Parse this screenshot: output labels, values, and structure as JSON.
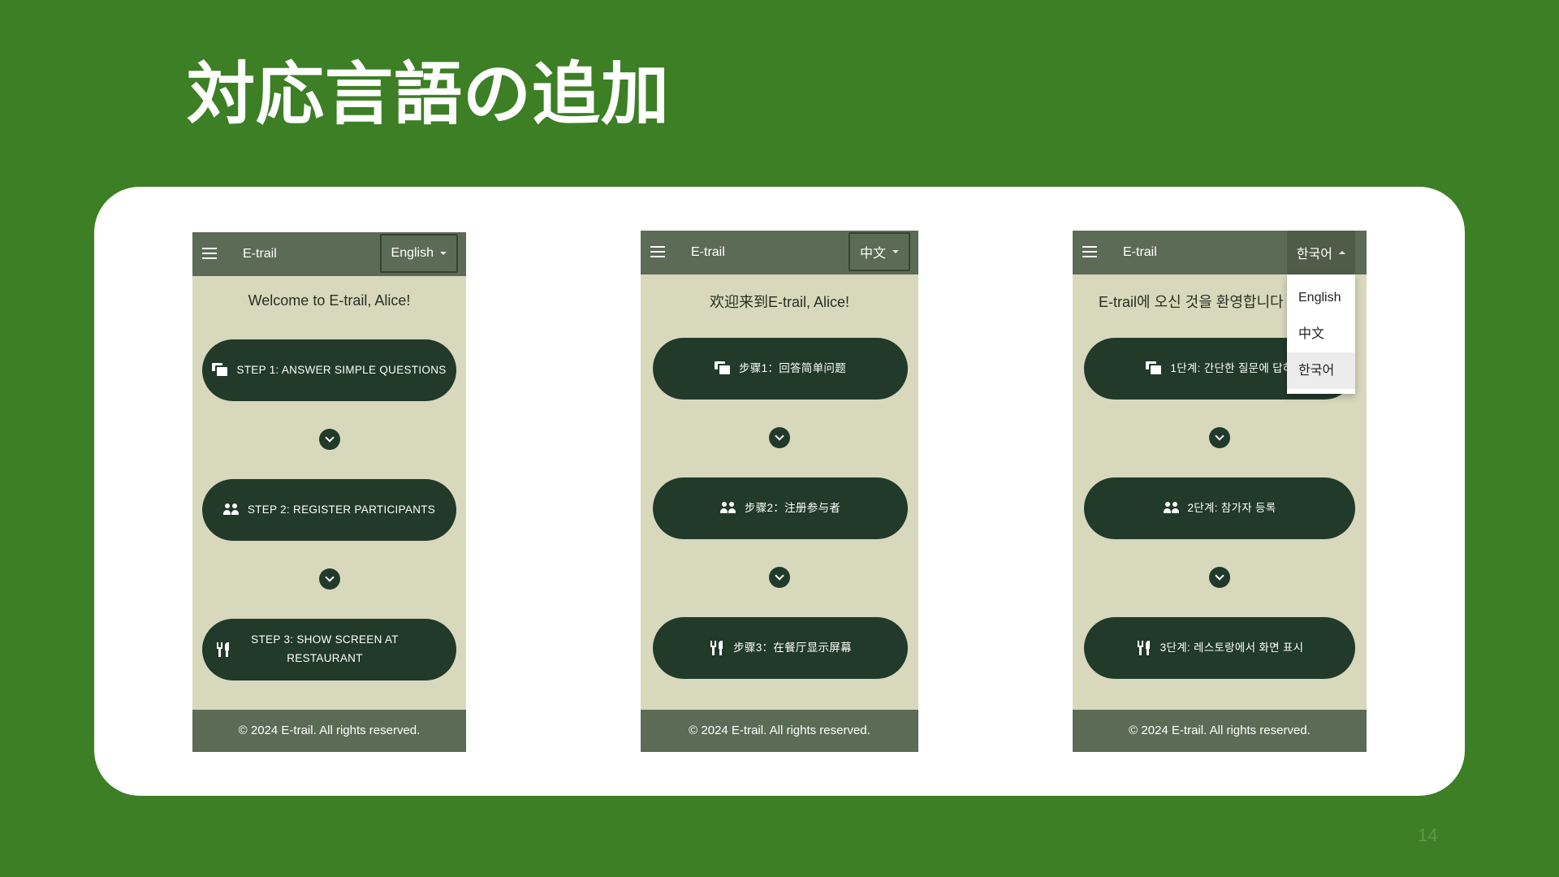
{
  "slide": {
    "title": "対応言語の追加",
    "page_number": "14"
  },
  "phones": [
    {
      "app_title": "E-trail",
      "language": "English",
      "welcome": "Welcome to E-trail, Alice!",
      "steps": [
        "STEP 1: ANSWER SIMPLE QUESTIONS",
        "STEP 2: REGISTER PARTICIPANTS",
        "STEP 3: SHOW SCREEN AT RESTAURANT"
      ],
      "footer": "© 2024 E-trail. All rights reserved."
    },
    {
      "app_title": "E-trail",
      "language": "中文",
      "welcome": "欢迎来到E-trail, Alice!",
      "steps": [
        "步骤1：回答简单问题",
        "步骤2：注册参与者",
        "步骤3：在餐厅显示屏幕"
      ],
      "footer": "© 2024 E-trail. All rights reserved."
    },
    {
      "app_title": "E-trail",
      "language": "한국어",
      "welcome": "E-trail에 오신 것을 환영합니다",
      "steps": [
        "1단계: 간단한 질문에 답하",
        "2단계: 참가자 등록",
        "3단계: 레스토랑에서 화면 표시"
      ],
      "footer": "© 2024 E-trail. All rights reserved.",
      "dropdown_options": [
        "English",
        "中文",
        "한국어"
      ],
      "dropdown_selected": "한국어"
    }
  ],
  "icons": {
    "menu": "menu-icon",
    "step1": "chat-icon",
    "step2": "people-icon",
    "step3": "restaurant-icon",
    "chevron": "chevron-down-icon"
  },
  "colors": {
    "background": "#3d7f24",
    "app_bar": "#5c6b55",
    "button": "#213a2a",
    "content": "#d8d8bd"
  }
}
